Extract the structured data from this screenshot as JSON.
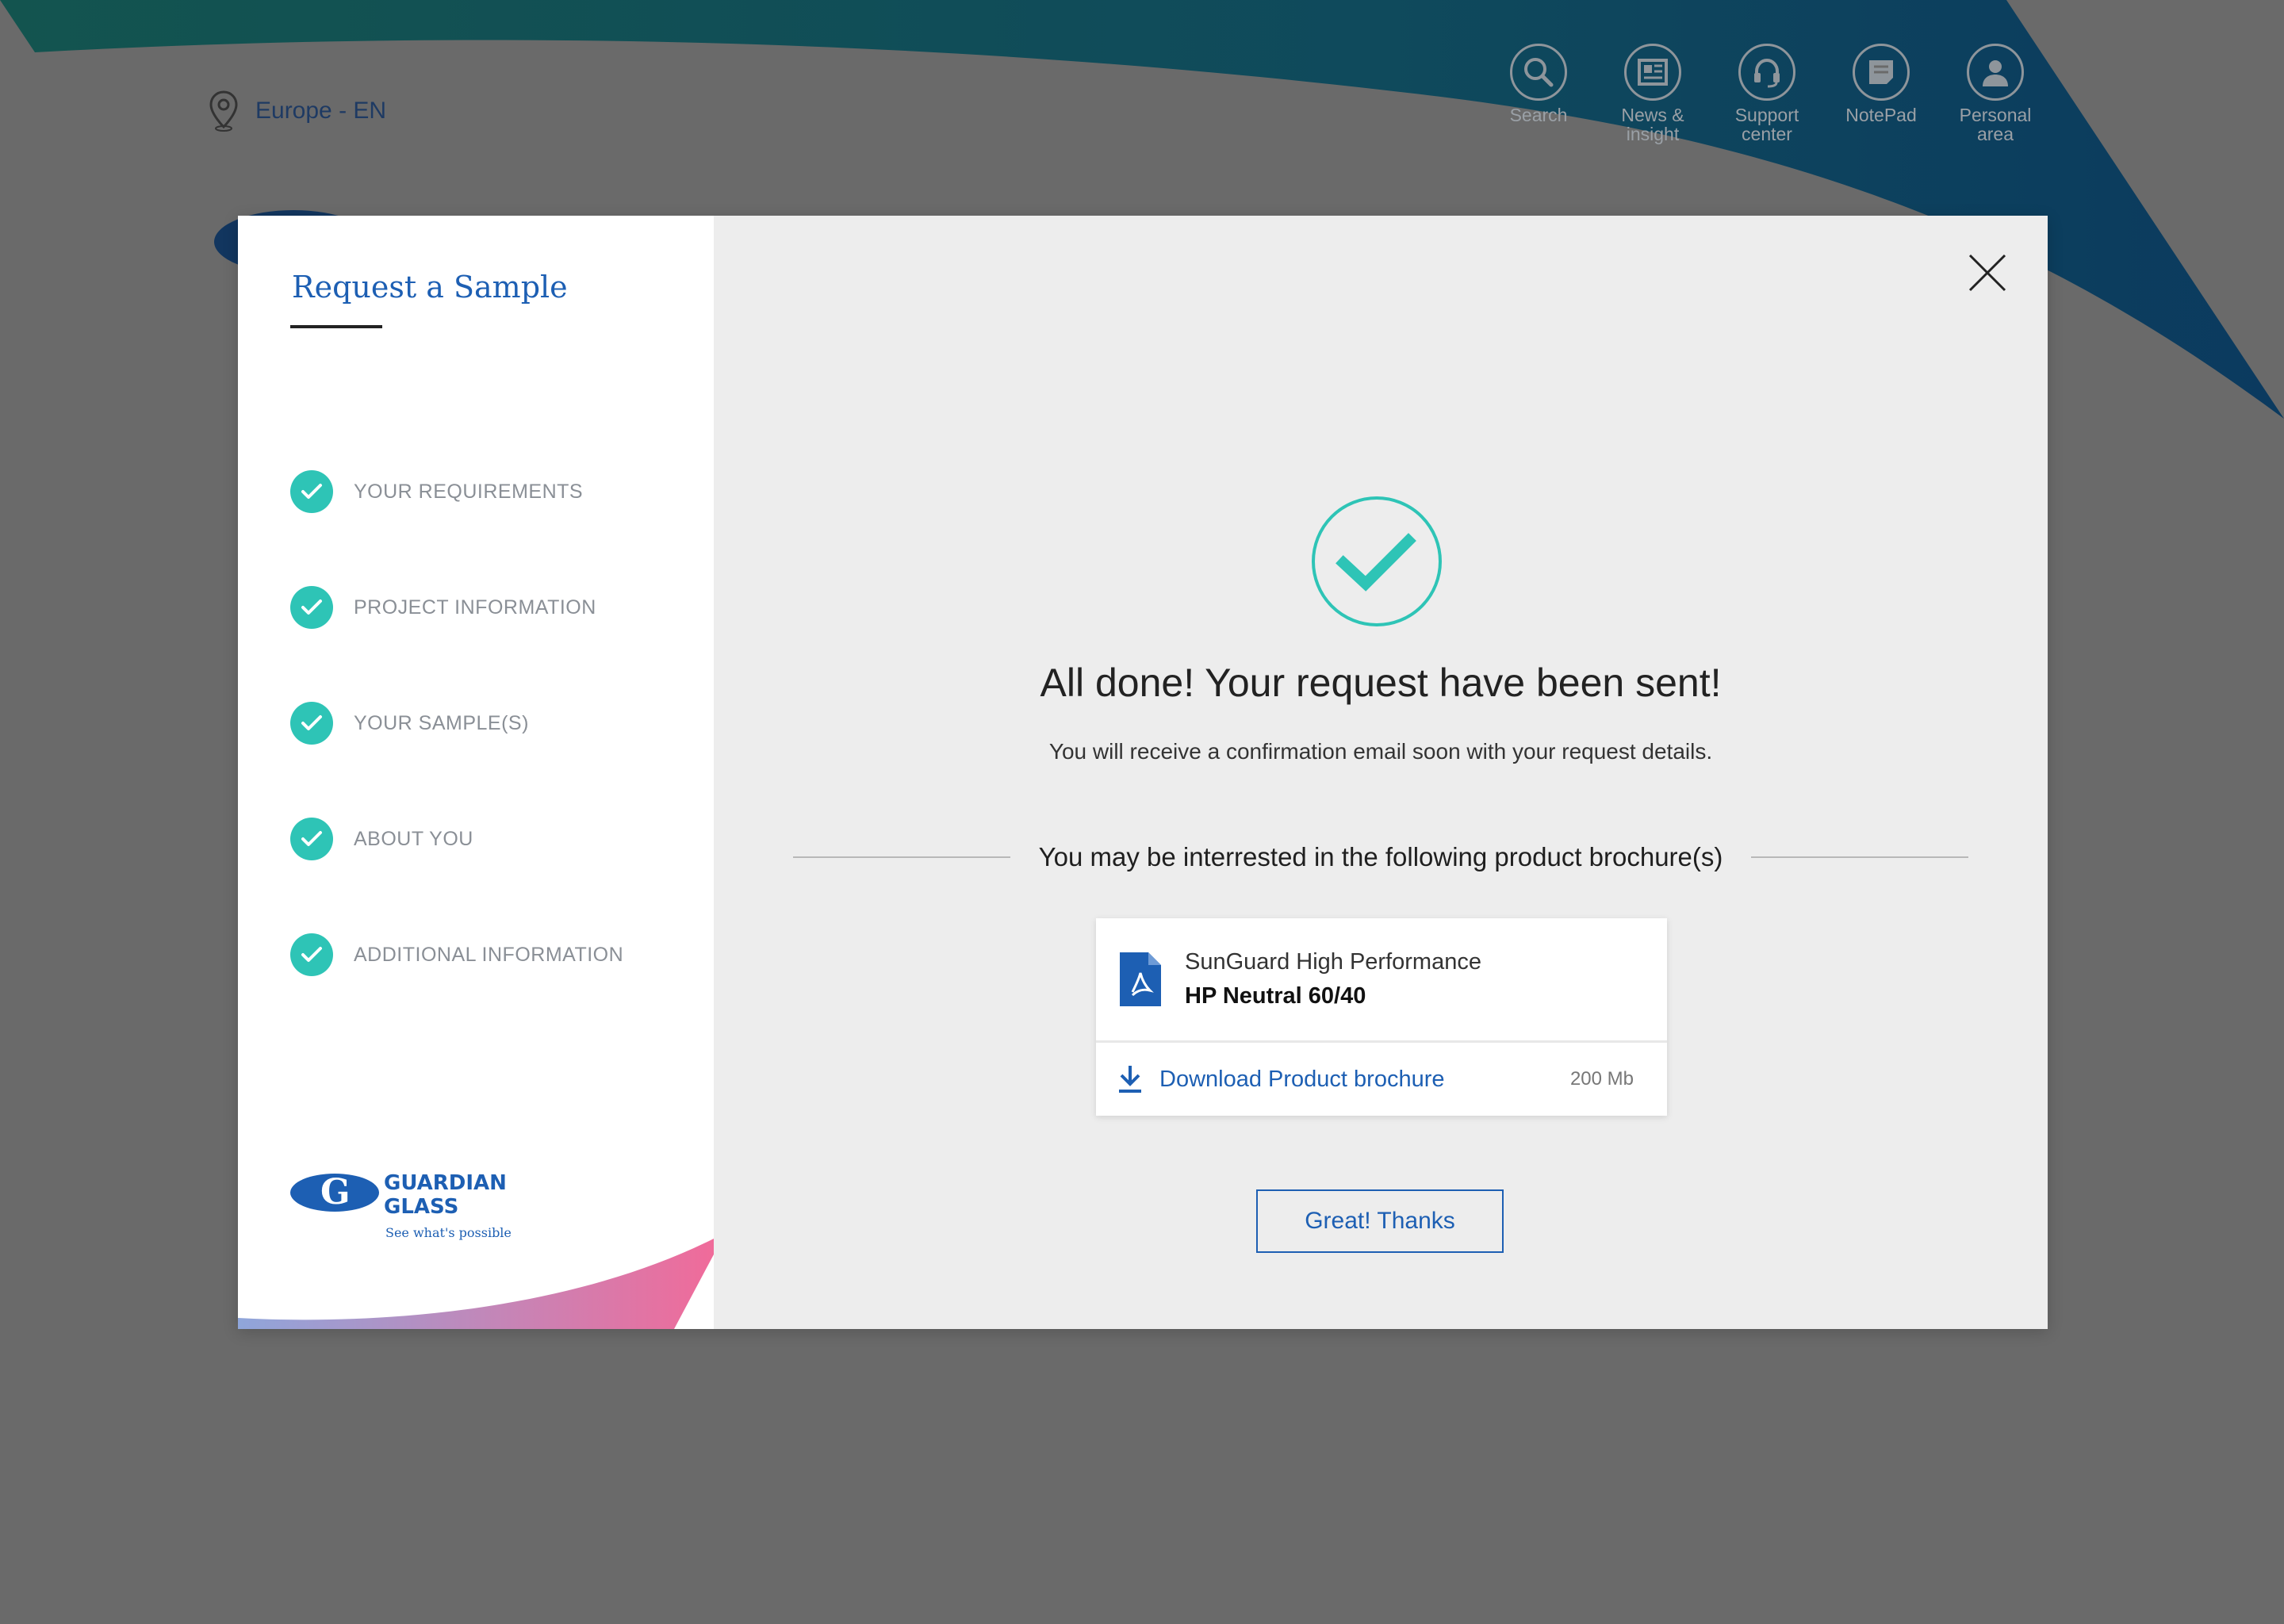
{
  "header": {
    "region": "Europe - EN",
    "nav": [
      {
        "icon": "search-icon",
        "label": "Search"
      },
      {
        "icon": "news-icon",
        "label": "News &\ninsight"
      },
      {
        "icon": "headset-icon",
        "label": "Support\ncenter"
      },
      {
        "icon": "notepad-icon",
        "label": "NotePad"
      },
      {
        "icon": "person-icon",
        "label": "Personal\narea"
      }
    ]
  },
  "modal": {
    "title": "Request a Sample",
    "steps": [
      {
        "label": "YOUR REQUIREMENTS",
        "status": "complete"
      },
      {
        "label": "PROJECT INFORMATION",
        "status": "complete"
      },
      {
        "label": "YOUR SAMPLE(S)",
        "status": "complete"
      },
      {
        "label": "ABOUT YOU",
        "status": "complete"
      },
      {
        "label": "ADDITIONAL INFORMATION",
        "status": "complete"
      }
    ],
    "logo": {
      "line1": "GUARDIAN",
      "line2": "GLASS",
      "tagline": "See what's possible"
    },
    "headline": "All done! Your request have been sent!",
    "subline": "You will receive a confirmation email soon with your request details.",
    "brochure_heading": "You may be interrested in the following product brochure(s)",
    "brochure": {
      "line1": "SunGuard High Performance",
      "line2": "HP Neutral 60/40",
      "download_label": "Download Product brochure",
      "size": "200 Mb"
    },
    "confirm_label": "Great! Thanks"
  },
  "colors": {
    "accent": "#1d5fb3",
    "success": "#2ec4b6",
    "overlay": "#6a6a6a"
  }
}
